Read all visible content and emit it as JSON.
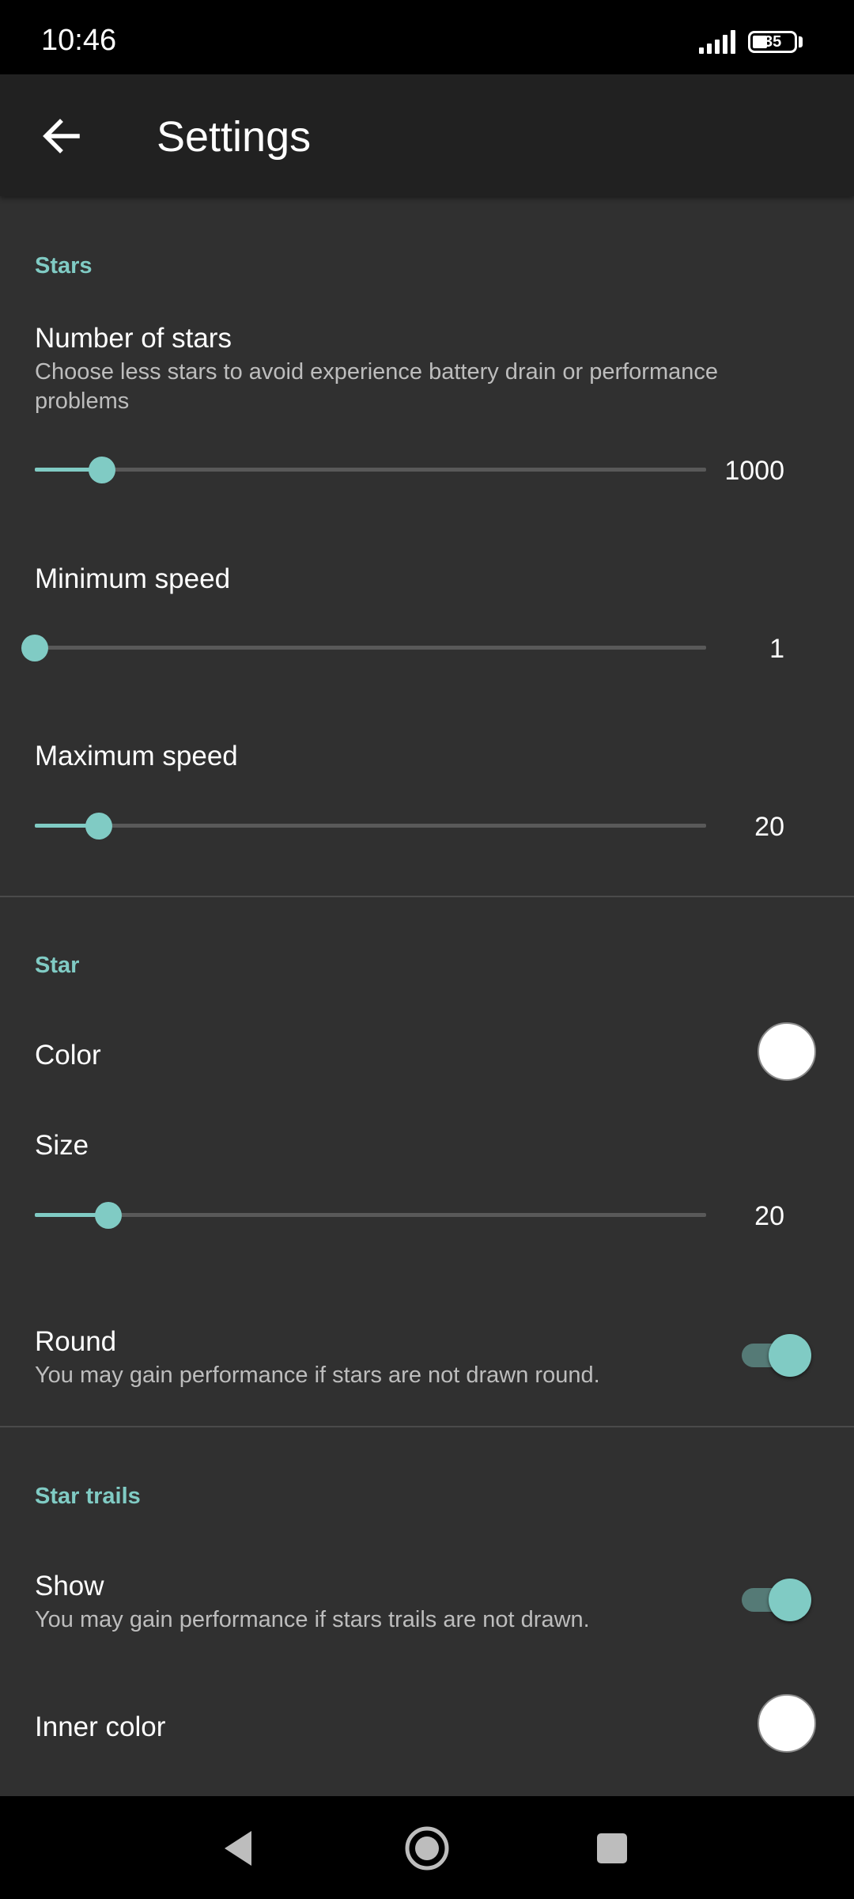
{
  "status": {
    "time": "10:46",
    "battery": "35"
  },
  "appbar": {
    "title": "Settings"
  },
  "stars_section": {
    "header": "Stars",
    "number_of_stars": {
      "title": "Number of stars",
      "summary": "Choose less stars to avoid experience battery drain or performance problems",
      "value": "1000",
      "fraction": 0.1
    },
    "minimum_speed": {
      "title": "Minimum speed",
      "value": "1",
      "fraction": 0.0
    },
    "maximum_speed": {
      "title": "Maximum speed",
      "value": "20",
      "fraction": 0.095
    }
  },
  "star_section": {
    "header": "Star",
    "color": {
      "title": "Color",
      "swatch": "#ffffff"
    },
    "size": {
      "title": "Size",
      "value": "20",
      "fraction": 0.11
    },
    "round": {
      "title": "Round",
      "summary": "You may gain performance if stars are not drawn round.",
      "checked": true
    }
  },
  "trails_section": {
    "header": "Star trails",
    "show": {
      "title": "Show",
      "summary": "You may gain performance if stars trails are not drawn.",
      "checked": true
    },
    "inner_color": {
      "title": "Inner color",
      "swatch": "#ffffff"
    }
  },
  "colors": {
    "accent": "#80cbc4",
    "background": "#303030",
    "appbar": "#212121"
  },
  "nav": {
    "icons": [
      "back-triangle-icon",
      "home-circle-icon",
      "recents-square-icon"
    ]
  }
}
